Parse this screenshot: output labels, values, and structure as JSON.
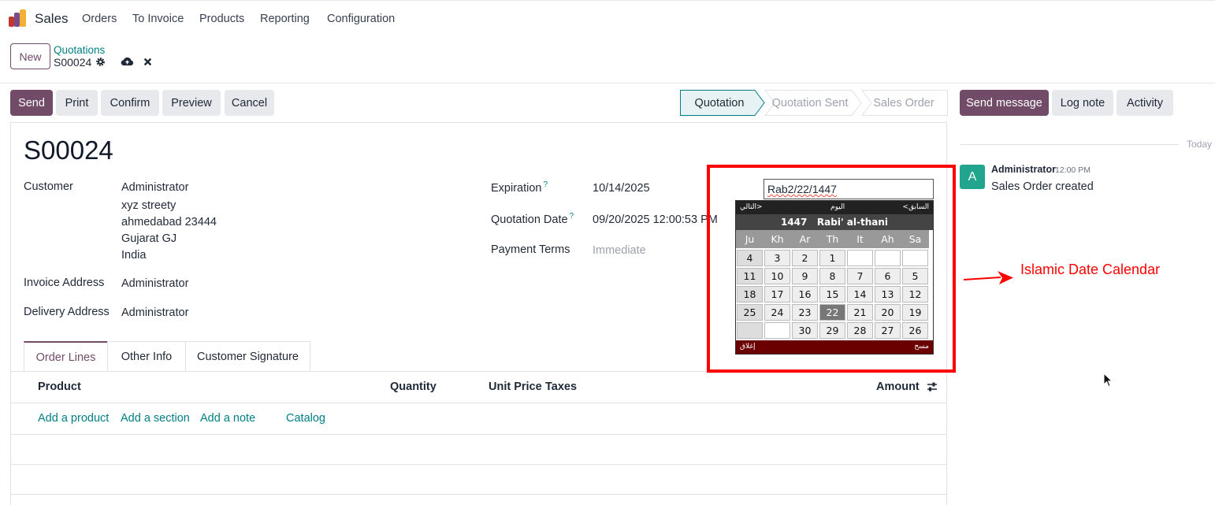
{
  "nav": {
    "app": "Sales",
    "items": [
      "Orders",
      "To Invoice",
      "Products",
      "Reporting",
      "Configuration"
    ]
  },
  "control": {
    "new_label": "New",
    "breadcrumb": "Quotations",
    "record": "S00024"
  },
  "actions": {
    "send": "Send",
    "print": "Print",
    "confirm": "Confirm",
    "preview": "Preview",
    "cancel": "Cancel"
  },
  "status_bar": {
    "steps": [
      "Quotation",
      "Quotation Sent",
      "Sales Order"
    ],
    "active": "Quotation"
  },
  "form": {
    "title": "S00024",
    "customer_label": "Customer",
    "customer_lines": [
      "Administrator",
      "xyz streety",
      "ahmedabad 23444",
      "Gujarat GJ",
      "India"
    ],
    "invoice_label": "Invoice Address",
    "invoice_value": "Administrator",
    "delivery_label": "Delivery Address",
    "delivery_value": "Administrator",
    "expiration_label": "Expiration",
    "expiration_value": "10/14/2025",
    "quotation_date_label": "Quotation Date",
    "quotation_date_value": "09/20/2025 12:00:53 PM",
    "payment_terms_label": "Payment Terms",
    "payment_terms_placeholder": "Immediate",
    "help_mark": "?"
  },
  "tabs": [
    "Order Lines",
    "Other Info",
    "Customer Signature"
  ],
  "table": {
    "headers": {
      "product": "Product",
      "quantity": "Quantity",
      "unit_price": "Unit Price",
      "taxes": "Taxes",
      "amount": "Amount"
    },
    "links": [
      "Add a product",
      "Add a section",
      "Add a note",
      "Catalog"
    ]
  },
  "calendar": {
    "input_value": "Rab2/22/1447",
    "next": "التالي>",
    "today": "اليوم",
    "prev": "<السابق",
    "month_title": "1447   Rabi' al-thani",
    "weekdays": [
      "Ju",
      "Kh",
      "Ar",
      "Th",
      "It",
      "Ah",
      "Sa"
    ],
    "weeks": [
      [
        "4",
        "3",
        "2",
        "1",
        "",
        "",
        ""
      ],
      [
        "11",
        "10",
        "9",
        "8",
        "7",
        "6",
        "5"
      ],
      [
        "18",
        "17",
        "16",
        "15",
        "14",
        "13",
        "12"
      ],
      [
        "25",
        "24",
        "23",
        "22",
        "21",
        "20",
        "19"
      ],
      [
        "",
        "",
        "30",
        "29",
        "28",
        "27",
        "26"
      ]
    ],
    "selected": "22",
    "close": "إغلاق",
    "clear": "مسح"
  },
  "annotation": "Islamic Date Calendar",
  "chatter": {
    "send_message": "Send message",
    "log_note": "Log note",
    "activity": "Activity",
    "today": "Today",
    "avatar_letter": "A",
    "author": "Administrator",
    "time": "12:00 PM",
    "message": "Sales Order created"
  },
  "colors": {
    "primary": "#714b67",
    "link": "#017e84",
    "annotation": "#ff0000",
    "avatar": "#21a58f"
  }
}
